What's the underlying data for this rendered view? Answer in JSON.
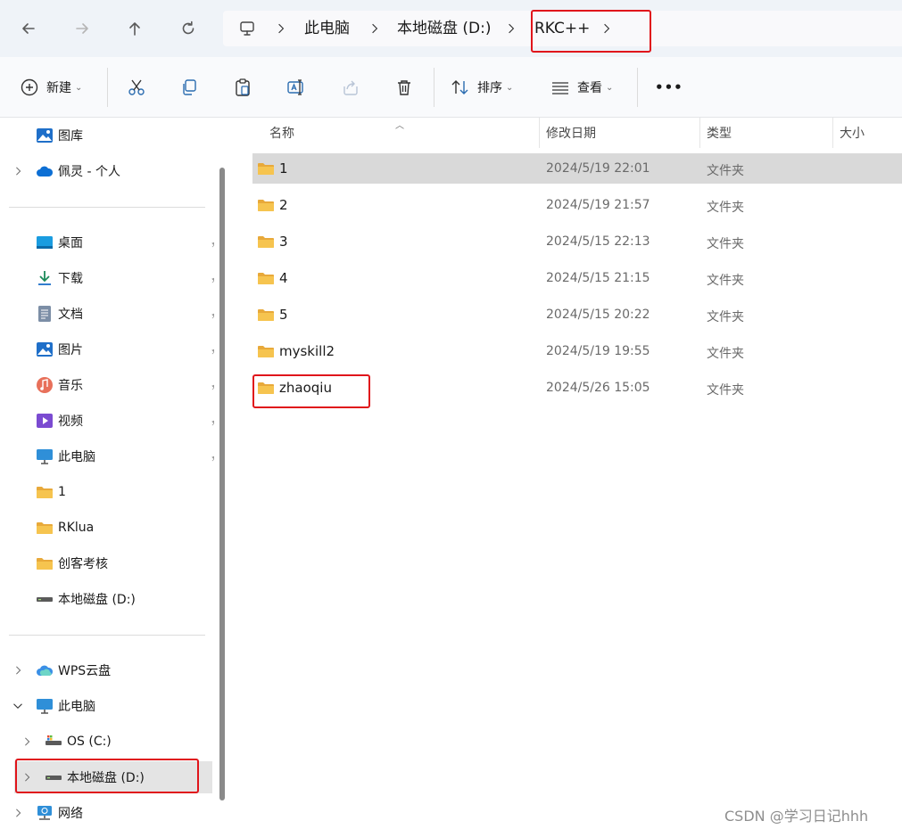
{
  "nav_buttons": {
    "back": "back-arrow-icon",
    "forward": "forward-arrow-icon",
    "up": "up-arrow-icon",
    "refresh": "refresh-icon"
  },
  "breadcrumb": {
    "root_icon": "computer-icon",
    "items": [
      "此电脑",
      "本地磁盘 (D:)",
      "RKC++"
    ]
  },
  "toolbar": {
    "new_label": "新建",
    "sort_label": "排序",
    "view_label": "查看",
    "more_label": "•••"
  },
  "sidebar": {
    "top_items": [
      {
        "label": "图库",
        "icon": "gallery-icon"
      },
      {
        "label": "佩灵 - 个人",
        "icon": "onedrive-cloud-icon"
      }
    ],
    "quick_access": [
      {
        "label": "桌面",
        "icon": "desktop-icon"
      },
      {
        "label": "下载",
        "icon": "download-icon"
      },
      {
        "label": "文档",
        "icon": "document-icon"
      },
      {
        "label": "图片",
        "icon": "pictures-icon"
      },
      {
        "label": "音乐",
        "icon": "music-icon"
      },
      {
        "label": "视频",
        "icon": "video-icon"
      },
      {
        "label": "此电脑",
        "icon": "this-pc-icon"
      },
      {
        "label": "1",
        "icon": "folder-icon"
      },
      {
        "label": "RKlua",
        "icon": "folder-icon"
      },
      {
        "label": "创客考核",
        "icon": "folder-icon"
      },
      {
        "label": "本地磁盘 (D:)",
        "icon": "drive-icon"
      }
    ],
    "tree": [
      {
        "label": "WPS云盘",
        "icon": "wps-cloud-icon"
      },
      {
        "label": "此电脑",
        "icon": "this-pc-icon"
      },
      {
        "label": "OS (C:)",
        "icon": "os-drive-icon"
      },
      {
        "label": "本地磁盘 (D:)",
        "icon": "drive-icon"
      },
      {
        "label": "网络",
        "icon": "network-icon"
      }
    ]
  },
  "columns": {
    "name": "名称",
    "date": "修改日期",
    "type": "类型",
    "size": "大小"
  },
  "files": [
    {
      "name": "1",
      "date": "2024/5/19 22:01",
      "type": "文件夹"
    },
    {
      "name": "2",
      "date": "2024/5/19 21:57",
      "type": "文件夹"
    },
    {
      "name": "3",
      "date": "2024/5/15 22:13",
      "type": "文件夹"
    },
    {
      "name": "4",
      "date": "2024/5/15 21:15",
      "type": "文件夹"
    },
    {
      "name": "5",
      "date": "2024/5/15 20:22",
      "type": "文件夹"
    },
    {
      "name": "myskill2",
      "date": "2024/5/19 19:55",
      "type": "文件夹"
    },
    {
      "name": "zhaoqiu",
      "date": "2024/5/26 15:05",
      "type": "文件夹"
    }
  ],
  "colors": {
    "highlight_box": "#e0151b",
    "folder": "#f6c44f",
    "selection": "#d9d9d9"
  },
  "watermark": "CSDN @学习日记hhh"
}
